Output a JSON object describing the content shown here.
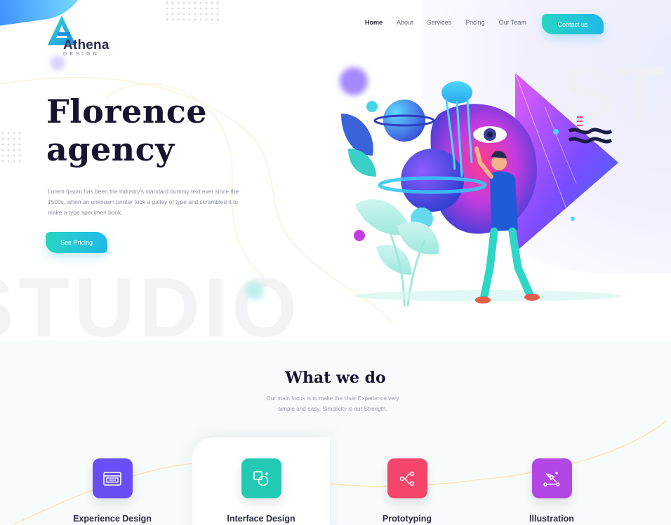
{
  "brand": {
    "name": "Athena",
    "tagline": "DESIGN",
    "accent_teal": "#27d5c1",
    "accent_blue": "#20b8e8",
    "title_color": "#17142f"
  },
  "nav": {
    "items": [
      {
        "label": "Home",
        "active": true
      },
      {
        "label": "About",
        "active": false
      },
      {
        "label": "Services",
        "active": false
      },
      {
        "label": "Pricing",
        "active": false
      },
      {
        "label": "Our Team",
        "active": false
      }
    ],
    "contact_label": "Contact us"
  },
  "hero": {
    "title_line1": "Florence",
    "title_line2": "agency",
    "body": "Lorem Ipsum has been the industry's standard dummy text ever since the 1500s, when an unknown printer took a galley of type and scrambled it to make a type specimen book.",
    "cta_label": "See Pricing",
    "bg_word": "STUDIO"
  },
  "services_section": {
    "title": "What we do",
    "subtitle": "Our main focus is to make the User Experience very simple and easy. Simplicity is our Strength.",
    "items": [
      {
        "label": "Experience Design",
        "icon": "browser-window-icon",
        "color": "#6a4ef5"
      },
      {
        "label": "Interface Design",
        "icon": "shapes-icon",
        "color": "#22c9b3"
      },
      {
        "label": "Prototyping",
        "icon": "flow-nodes-icon",
        "color": "#f5456a"
      },
      {
        "label": "Illustration",
        "icon": "pen-tool-icon",
        "color": "#b347e6"
      }
    ]
  }
}
